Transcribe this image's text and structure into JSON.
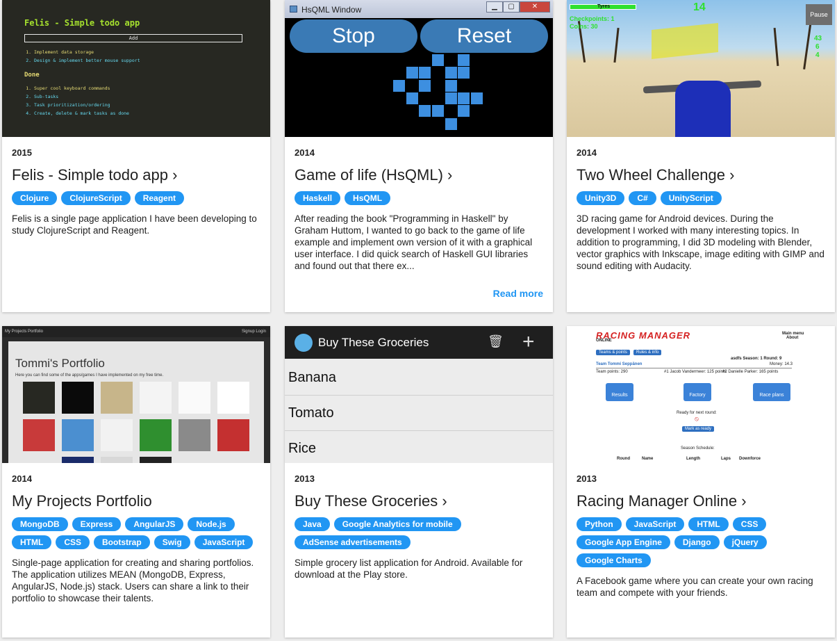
{
  "cards": [
    {
      "year": "2015",
      "title": "Felis - Simple todo app ›",
      "tags": [
        "Clojure",
        "ClojureScript",
        "Reagent"
      ],
      "description": "Felis is a single page application I have been developing to study ClojureScript and Reagent.",
      "screenshot": {
        "heading": "Felis - Simple todo app",
        "add_label": "Add",
        "todo": [
          "Implement data storage",
          "Design & implement better mouse support"
        ],
        "done_heading": "Done",
        "done": [
          "Super cool keyboard commands",
          "Sub-tasks",
          "Task prioritization/ordering",
          "Create, delete & mark tasks as done"
        ]
      }
    },
    {
      "year": "2014",
      "title": "Game of life (HsQML) ›",
      "tags": [
        "Haskell",
        "HsQML"
      ],
      "description": "After reading the book \"Programming in Haskell\" by Graham Huttom, I wanted to go back to the game of life example and implement own version of it with a graphical user interface. I did quick search of Haskell GUI libraries and found out that there ex...",
      "read_more": "Read more",
      "screenshot": {
        "window_title": "HsQML Window",
        "stop_label": "Stop",
        "reset_label": "Reset"
      }
    },
    {
      "year": "2014",
      "title": "Two Wheel Challenge ›",
      "tags": [
        "Unity3D",
        "C#",
        "UnityScript"
      ],
      "description": "3D racing game for Android devices. During the development I worked with many interesting topics. In addition to programming, I did 3D modeling with Blender, vector graphics with Inkscape, image editing with GIMP and sound editing with Audacity.",
      "screenshot": {
        "tyres_label": "Tyres",
        "score": "14",
        "checkpoints": "Checkpoints: 1",
        "coins": "Coins: 30",
        "pause_label": "Pause",
        "speed": "43",
        "stat2": "6",
        "stat3": "4"
      }
    },
    {
      "year": "2014",
      "title": "My Projects Portfolio",
      "tags": [
        "MongoDB",
        "Express",
        "AngularJS",
        "Node.js",
        "HTML",
        "CSS",
        "Bootstrap",
        "Swig",
        "JavaScript"
      ],
      "description": "Single-page application for creating and sharing portfolios. The application utilizes MEAN (MongoDB, Express, AngularJS, Node.js) stack. Users can share a link to their portfolio to showcase their talents.",
      "screenshot": {
        "nav_title": "My Projects Portfolio",
        "nav_right": "Signup   Login",
        "heading": "Tommi's Portfolio",
        "subheading": "Here you can find some of the apps/games I have implemented on my free time."
      }
    },
    {
      "year": "2013",
      "title": "Buy These Groceries ›",
      "tags": [
        "Java",
        "Google Analytics for mobile",
        "AdSense advertisements"
      ],
      "description": "Simple grocery list application for Android. Available for download at the Play store.",
      "screenshot": {
        "app_title": "Buy These Groceries",
        "items": [
          "Banana",
          "Tomato",
          "Rice"
        ]
      }
    },
    {
      "year": "2013",
      "title": "Racing Manager Online ›",
      "tags": [
        "Python",
        "JavaScript",
        "HTML",
        "CSS",
        "Google App Engine",
        "Django",
        "jQuery",
        "Google Charts"
      ],
      "description": "A Facebook game where you can create your own racing team and compete with your friends.",
      "screenshot": {
        "logo": "RACING  MANAGER",
        "logo_sub": "ONLINE",
        "menu": "Main menu",
        "about": "About",
        "btn_teams": "Teams & points",
        "btn_rules": "Rules & info",
        "user_line": "asdfs Season: 1 Round: 9",
        "money": "Money: 14.3",
        "team_name": "Team Tommi Seppänen",
        "team_points": "Team points: 290",
        "driver1": "#1 Jacob Vandermeer: 125 points",
        "driver2": "#2 Danielle Parker: 165 points",
        "btn_results": "Results",
        "btn_factory": "Factory",
        "btn_raceplans": "Race plans",
        "ready_label": "Ready for next round:",
        "mark_ready": "Mark as ready",
        "schedule": "Season Schedule:",
        "col_round": "Round",
        "col_name": "Name",
        "col_length": "Length",
        "col_laps": "Laps",
        "col_downforce": "Downforce"
      }
    }
  ]
}
